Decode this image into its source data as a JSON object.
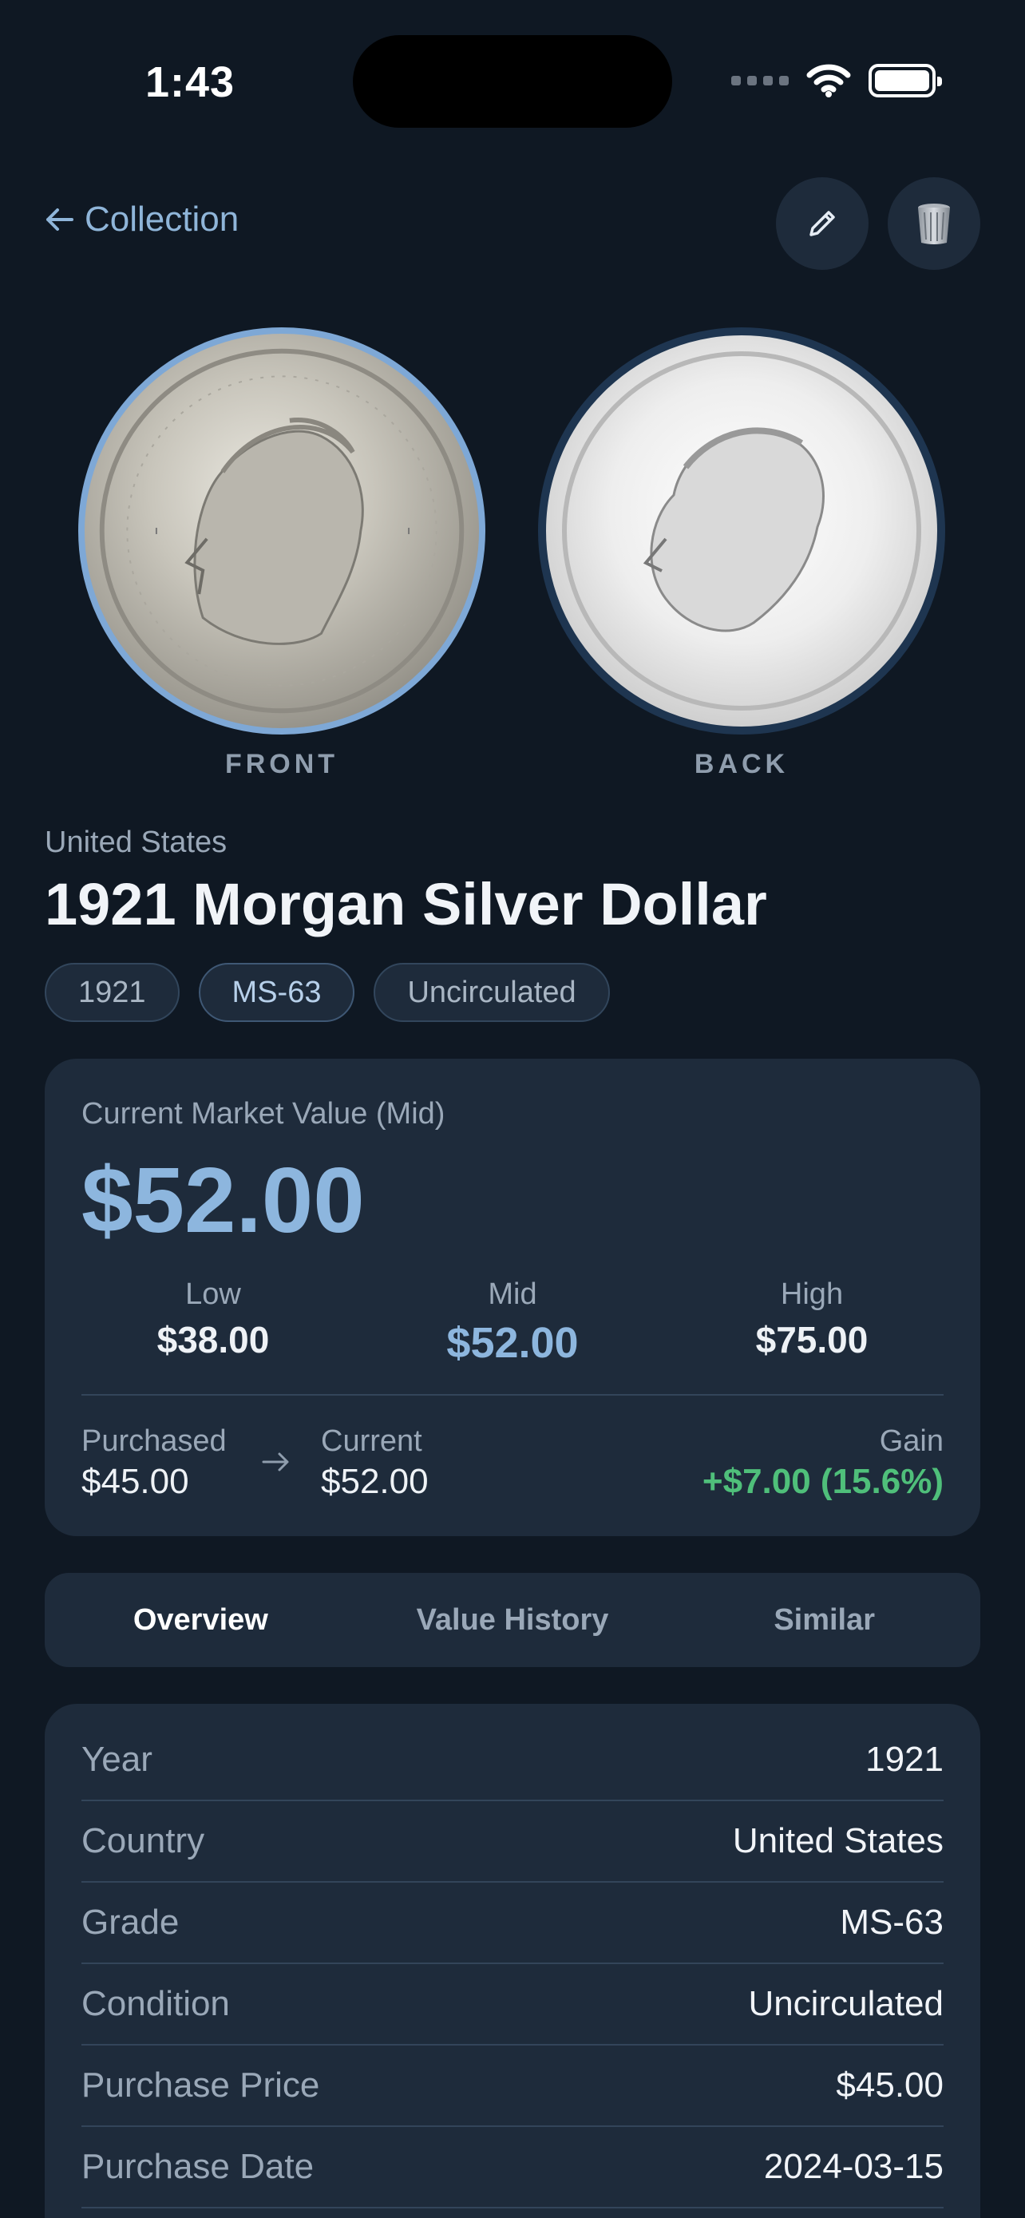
{
  "status_bar": {
    "time": "1:43"
  },
  "nav": {
    "back_label": "Collection"
  },
  "coins": {
    "front_label": "FRONT",
    "back_label": "BACK"
  },
  "header": {
    "country": "United States",
    "title": "1921 Morgan Silver Dollar",
    "tags": [
      "1921",
      "MS-63",
      "Uncirculated"
    ]
  },
  "value_card": {
    "label": "Current Market Value (Mid)",
    "price": "$52.00",
    "low_label": "Low",
    "low_value": "$38.00",
    "mid_label": "Mid",
    "mid_value": "$52.00",
    "high_label": "High",
    "high_value": "$75.00",
    "purchased_label": "Purchased",
    "purchased_value": "$45.00",
    "current_label": "Current",
    "current_value": "$52.00",
    "gain_label": "Gain",
    "gain_value": "+$7.00 (15.6%)"
  },
  "tabs": [
    "Overview",
    "Value History",
    "Similar"
  ],
  "details": [
    {
      "key": "Year",
      "value": "1921"
    },
    {
      "key": "Country",
      "value": "United States"
    },
    {
      "key": "Grade",
      "value": "MS-63"
    },
    {
      "key": "Condition",
      "value": "Uncirculated"
    },
    {
      "key": "Purchase Price",
      "value": "$45.00"
    },
    {
      "key": "Purchase Date",
      "value": "2024-03-15"
    }
  ],
  "colors": {
    "accent": "#8db6de",
    "gain": "#4fbf7a",
    "background": "#0f1823",
    "card": "#1e2b3b"
  }
}
